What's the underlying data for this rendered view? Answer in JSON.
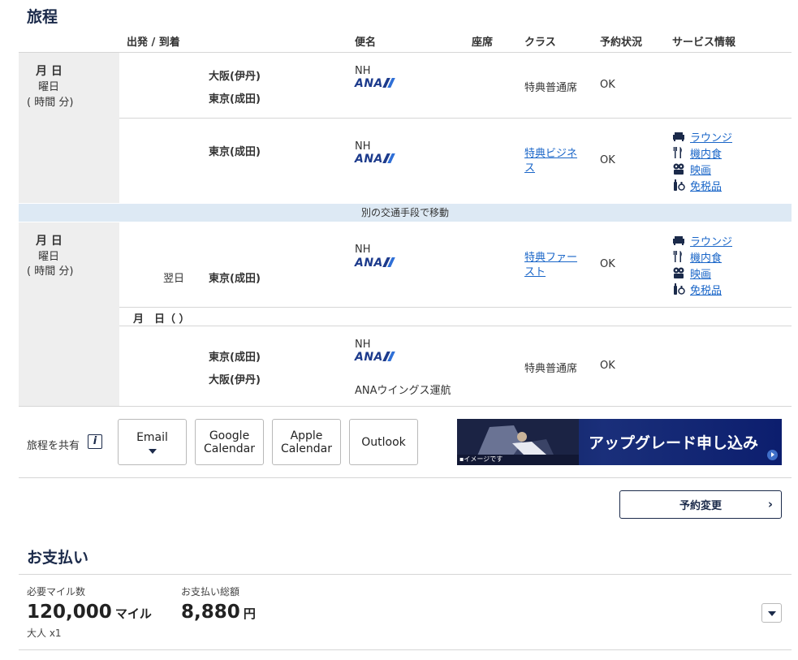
{
  "itinerary": {
    "title": "旅程",
    "headers": {
      "depart": "出発 / 到着",
      "flight": "便名",
      "seat": "座席",
      "class": "クラス",
      "status": "予約状況",
      "service": "サービス情報"
    },
    "day1": {
      "date": "月 日",
      "weekday": "曜日",
      "duration": "( 時間 分)"
    },
    "seg1": {
      "from": "大阪(伊丹)",
      "to": "東京(成田)",
      "airline": "NH",
      "logo": "ANA",
      "class": "特典普通席",
      "status": "OK"
    },
    "seg2": {
      "to": "東京(成田)",
      "airline": "NH",
      "logo": "ANA",
      "class_line1": "特典ビジネ",
      "class_line2": "ス",
      "status": "OK",
      "services": [
        "ラウンジ",
        "機内食",
        "映画",
        "免税品"
      ]
    },
    "transfer": "別の交通手段で移動",
    "day2": {
      "date": "月 日",
      "weekday": "曜日",
      "duration": "( 時間 分)"
    },
    "seg3": {
      "next_day": "翌日",
      "to": "東京(成田)",
      "airline": "NH",
      "logo": "ANA",
      "class_line1": "特典ファー",
      "class_line2": "スト",
      "status": "OK",
      "services": [
        "ラウンジ",
        "機内食",
        "映画",
        "免税品"
      ]
    },
    "subdate": "月　日（ ）",
    "seg4": {
      "from": "東京(成田)",
      "to": "大阪(伊丹)",
      "airline": "NH",
      "logo": "ANA",
      "operated": "ANAウイングス運航",
      "class": "特典普通席",
      "status": "OK"
    }
  },
  "share": {
    "label": "旅程を共有",
    "info_icon": "i",
    "email": "Email",
    "google_line1": "Google",
    "google_line2": "Calendar",
    "apple_line1": "Apple",
    "apple_line2": "Calendar",
    "outlook": "Outlook",
    "banner_text": "アップグレード申し込み",
    "banner_note": "▪イメージです"
  },
  "change_button": "予約変更",
  "payment": {
    "title": "お支払い",
    "miles_label": "必要マイル数",
    "miles_value": "120,000",
    "miles_unit": "マイル",
    "pax": "大人 x1",
    "total_label": "お支払い総額",
    "total_value": "8,880",
    "total_unit": "円"
  },
  "colors": {
    "accent": "#1b2a4a",
    "link": "#1a66c8",
    "band": "#dde9f4",
    "ana": "#1d3b8c"
  }
}
